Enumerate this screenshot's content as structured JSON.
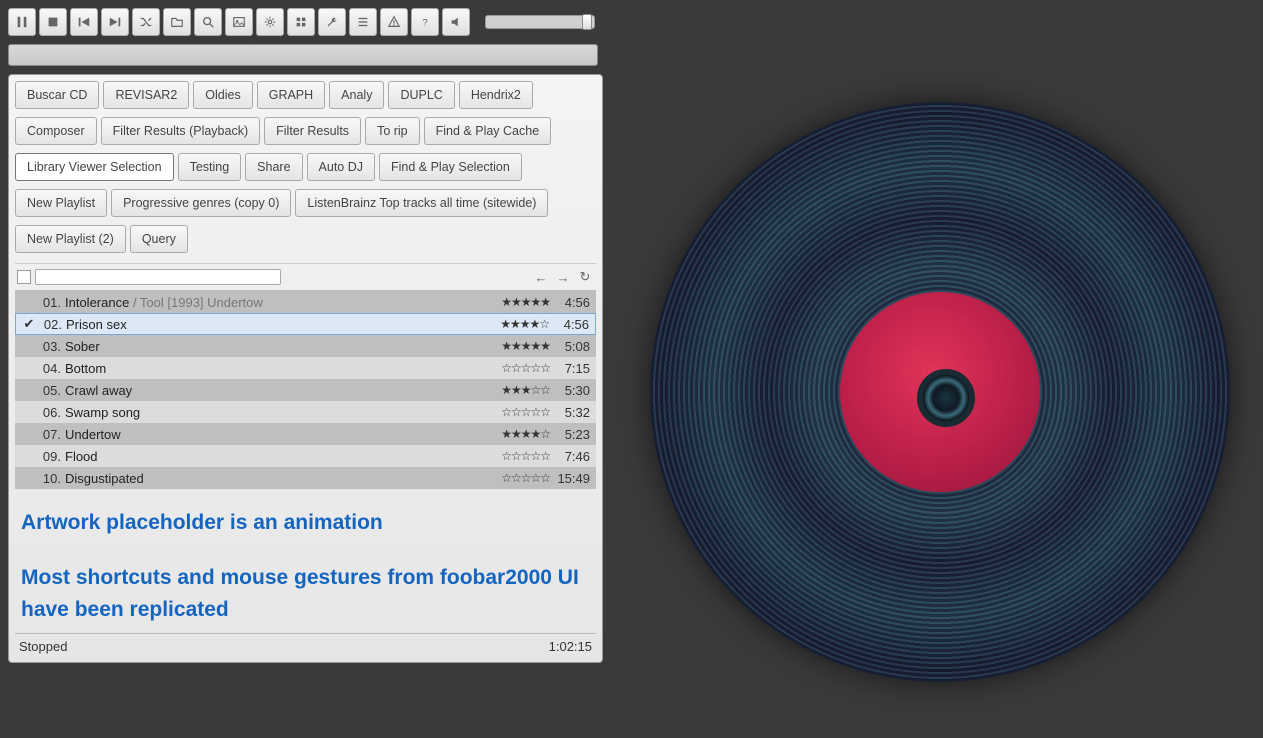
{
  "toolbar": {
    "buttons": [
      "pause",
      "stop",
      "prev",
      "next",
      "shuffle",
      "open",
      "search",
      "image",
      "settings",
      "tools",
      "wrench",
      "list",
      "warning",
      "help",
      "mute"
    ]
  },
  "tabs": {
    "row1": [
      "Buscar CD",
      "REVISAR2",
      "Oldies",
      "GRAPH",
      "Analy",
      "DUPLC",
      "Hendrix2"
    ],
    "row2": [
      "Composer",
      "Filter Results (Playback)",
      "Filter Results",
      "To rip",
      "Find & Play Cache"
    ],
    "row3": [
      "Library Viewer Selection",
      "Testing",
      "Share",
      "Auto DJ",
      "Find & Play Selection"
    ],
    "row4": [
      "New Playlist",
      "Progressive genres (copy 0)",
      "ListenBrainz Top tracks all time (sitewide)"
    ],
    "row5": [
      "New Playlist (2)",
      "Query"
    ],
    "active": "Library Viewer Selection"
  },
  "tracks": [
    {
      "n": "01.",
      "title": "Intolerance",
      "sub": " / Tool [1993] Undertow",
      "rating": "★★★★★",
      "dur": "4:56",
      "sel": false
    },
    {
      "n": "02.",
      "title": "Prison sex",
      "sub": "",
      "rating": "★★★★☆",
      "dur": "4:56",
      "sel": true
    },
    {
      "n": "03.",
      "title": "Sober",
      "sub": "",
      "rating": "★★★★★",
      "dur": "5:08",
      "sel": false
    },
    {
      "n": "04.",
      "title": "Bottom",
      "sub": "",
      "rating": "☆☆☆☆☆",
      "dur": "7:15",
      "sel": false
    },
    {
      "n": "05.",
      "title": "Crawl away",
      "sub": "",
      "rating": "★★★☆☆",
      "dur": "5:30",
      "sel": false
    },
    {
      "n": "06.",
      "title": "Swamp song",
      "sub": "",
      "rating": "☆☆☆☆☆",
      "dur": "5:32",
      "sel": false
    },
    {
      "n": "07.",
      "title": "Undertow",
      "sub": "",
      "rating": "★★★★☆",
      "dur": "5:23",
      "sel": false
    },
    {
      "n": "09.",
      "title": "Flood",
      "sub": "",
      "rating": "☆☆☆☆☆",
      "dur": "7:46",
      "sel": false
    },
    {
      "n": "10.",
      "title": "Disgustipated",
      "sub": "",
      "rating": "☆☆☆☆☆",
      "dur": "15:49",
      "sel": false
    }
  ],
  "annotation": {
    "line1": "Artwork placeholder is an animation",
    "line2": "Most shortcuts and mouse gestures from foobar2000 UI have been replicated"
  },
  "status": {
    "left": "Stopped",
    "right": "1:02:15"
  },
  "nav": {
    "back": "←",
    "fwd": "→",
    "reload": "↻"
  }
}
